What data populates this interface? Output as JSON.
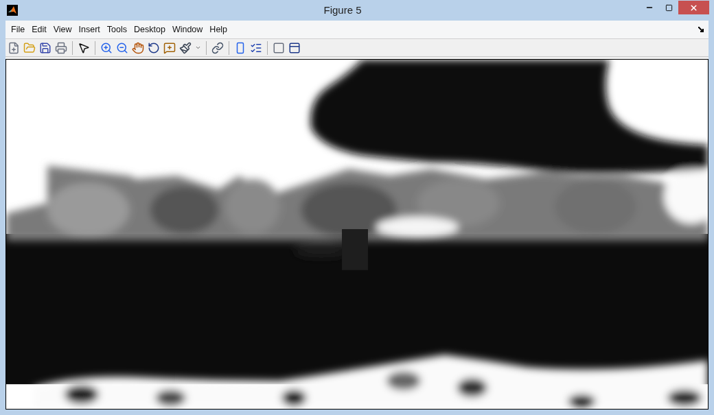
{
  "window": {
    "title": "Figure 5"
  },
  "menu": [
    "File",
    "Edit",
    "View",
    "Insert",
    "Tools",
    "Desktop",
    "Window",
    "Help"
  ]
}
